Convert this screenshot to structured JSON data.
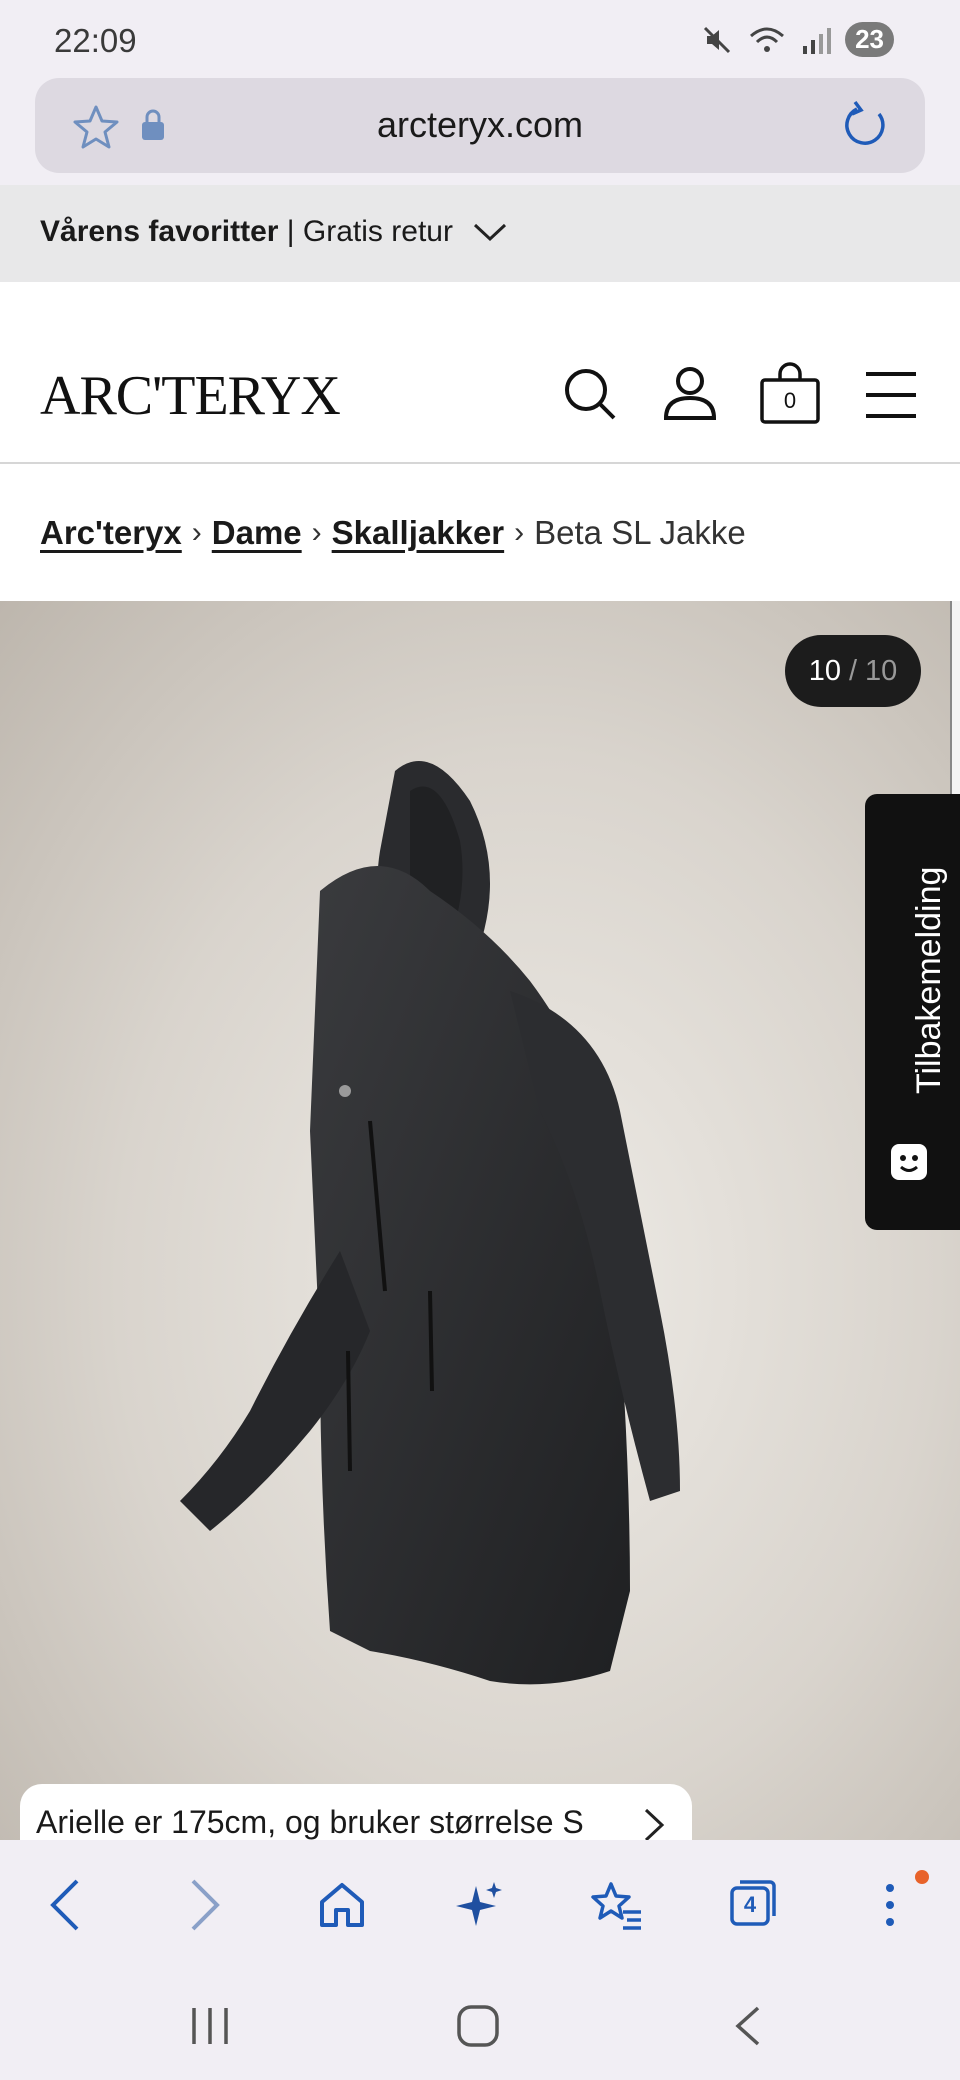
{
  "status": {
    "time": "22:09",
    "notifications_count": "23"
  },
  "browser": {
    "url": "arcteryx.com",
    "tabs_count": "4"
  },
  "promo": {
    "bold_text": "Vårens favoritter",
    "separator": "|",
    "text": "Gratis retur"
  },
  "header": {
    "logo": "ARC'TERYX",
    "cart_count": "0"
  },
  "breadcrumb": {
    "items": [
      {
        "label": "Arc'teryx"
      },
      {
        "label": "Dame"
      },
      {
        "label": "Skalljakker"
      }
    ],
    "current": "Beta SL Jakke"
  },
  "gallery": {
    "current": "10",
    "separator": "/",
    "total": "10",
    "progress": 1.0
  },
  "feedback": {
    "label": "Tilbakemelding"
  },
  "model_info": {
    "text": "Arielle er 175cm, og bruker størrelse S"
  },
  "colors": {
    "accent_blue": "#1f5bb8",
    "notification_dot": "#e8622a",
    "feedback_bg": "#111111"
  }
}
